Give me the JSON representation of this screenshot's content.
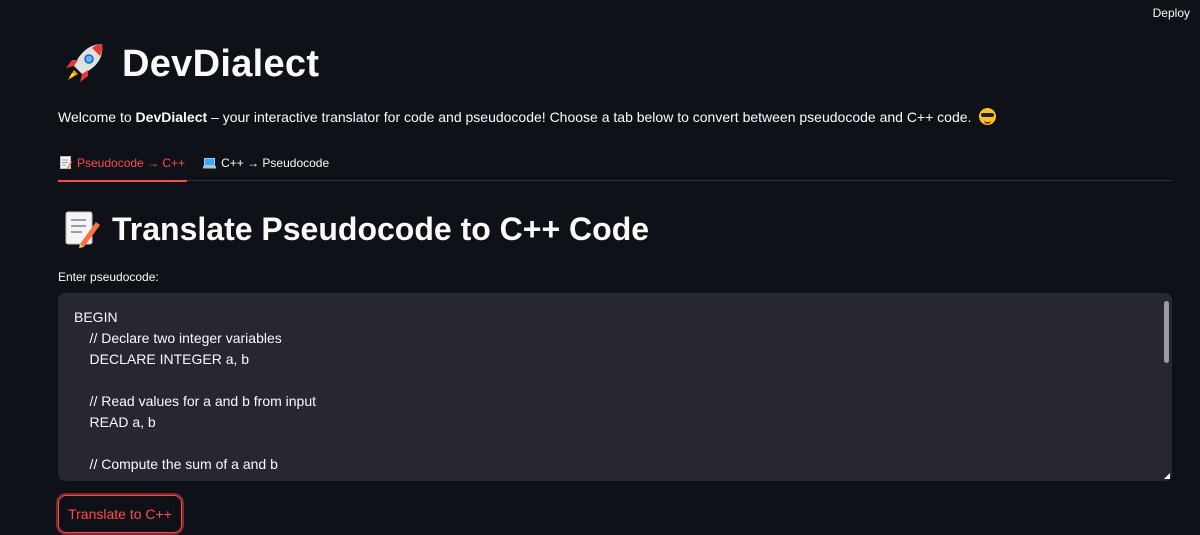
{
  "header": {
    "deploy_label": "Deploy"
  },
  "app": {
    "title": "DevDialect",
    "intro_prefix": "Welcome to ",
    "intro_brand": "DevDialect",
    "intro_suffix": " – your interactive translator for code and pseudocode! Choose a tab below to convert between pseudocode and C++ code. "
  },
  "tabs": [
    {
      "label": "Pseudocode → C++",
      "active": true,
      "icon": "memo-icon"
    },
    {
      "label": "C++ → Pseudocode",
      "active": false,
      "icon": "laptop-icon"
    }
  ],
  "section": {
    "heading": "Translate Pseudocode to C++ Code",
    "input_label": "Enter pseudocode:",
    "input_value": "BEGIN\n    // Declare two integer variables\n    DECLARE INTEGER a, b\n\n    // Read values for a and b from input\n    READ a, b\n\n    // Compute the sum of a and b",
    "button_label": "Translate to C++"
  },
  "colors": {
    "background": "#0e1117",
    "accent": "#ff4b4b",
    "input_bg": "#262730"
  }
}
